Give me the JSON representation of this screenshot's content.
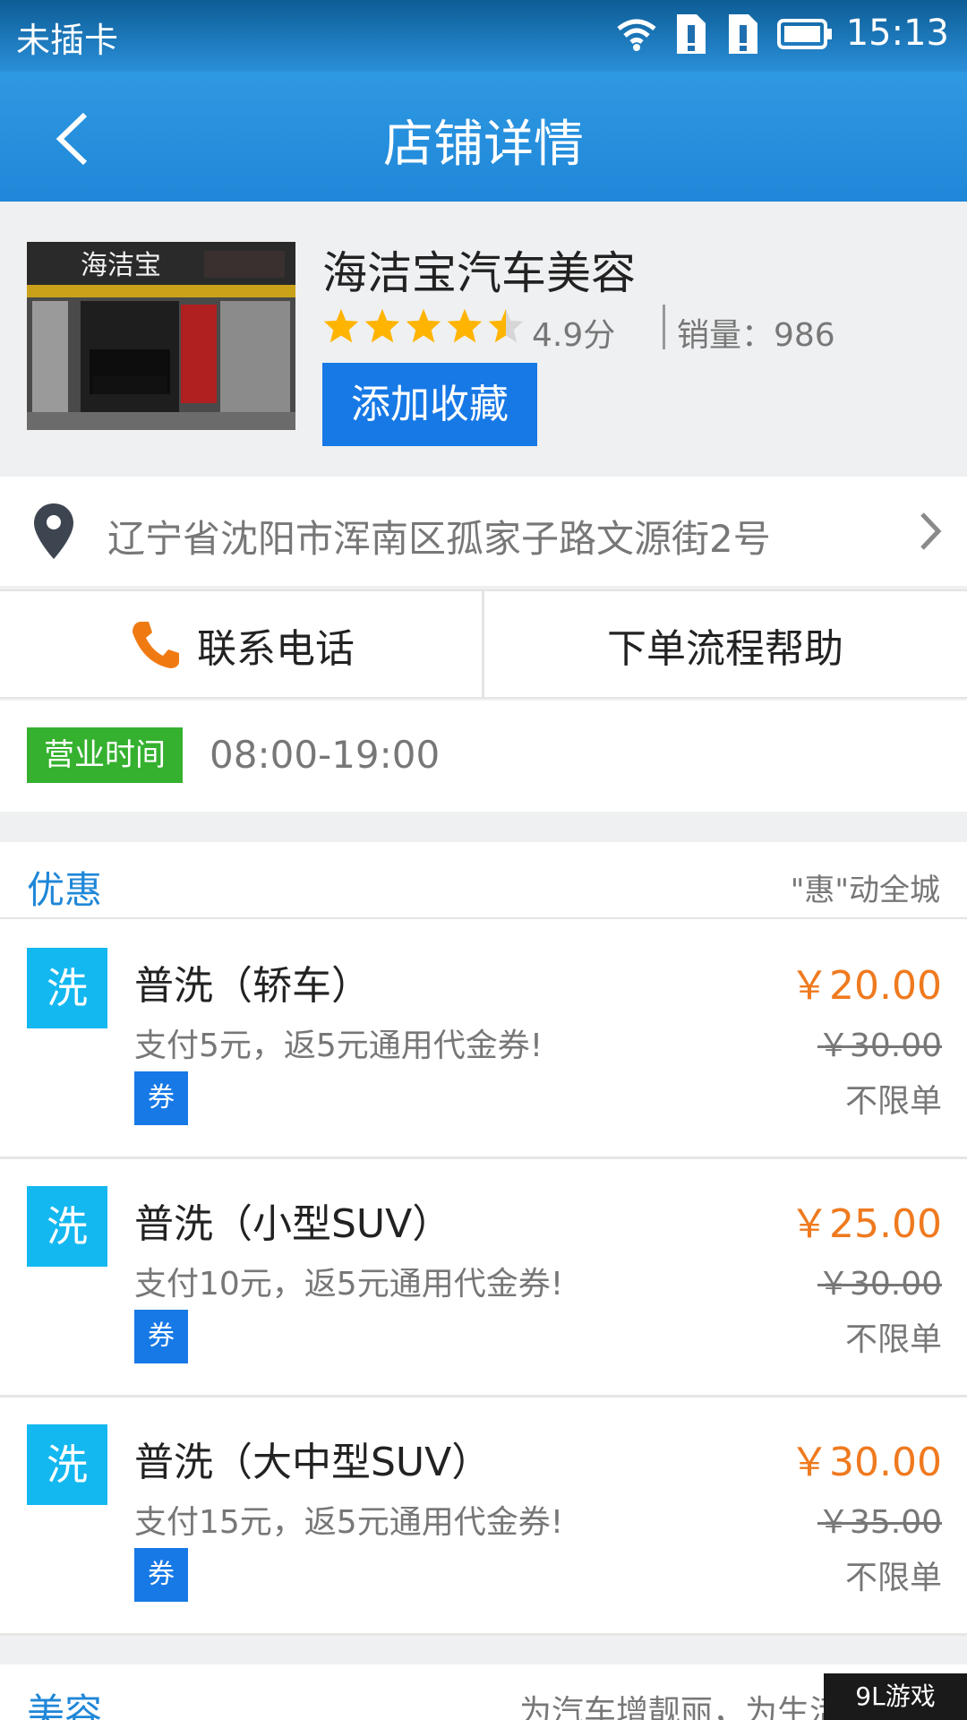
{
  "status_bar": {
    "carrier": "未插卡",
    "time": "15:13",
    "icons": [
      "wifi-icon",
      "sim-alert-icon",
      "sim-alert-icon",
      "battery-icon"
    ]
  },
  "nav": {
    "title": "店铺详情",
    "back_icon": "chevron-left-icon"
  },
  "store": {
    "name": "海洁宝汽车美容",
    "rating": 4.5,
    "score_text": "4.9分",
    "sales_text": "销量：986",
    "favorite_label": "添加收藏",
    "photo_sign": "海洁宝"
  },
  "address": {
    "text": "辽宁省沈阳市浑南区孤家子路文源街2号"
  },
  "actions": {
    "phone_label": "联系电话",
    "help_label": "下单流程帮助"
  },
  "hours": {
    "tag": "营业时间",
    "value": "08:00-19:00"
  },
  "deals": {
    "title": "优惠",
    "subtitle": "\"惠\"动全城",
    "items": [
      {
        "icon_text": "洗",
        "name": "普洗（轿车）",
        "desc": "支付5元，返5元通用代金券!",
        "coupon": "券",
        "price": "￥20.00",
        "original": "￥30.00",
        "limit": "不限单"
      },
      {
        "icon_text": "洗",
        "name": "普洗（小型SUV）",
        "desc": "支付10元，返5元通用代金券!",
        "coupon": "券",
        "price": "￥25.00",
        "original": "￥30.00",
        "limit": "不限单"
      },
      {
        "icon_text": "洗",
        "name": "普洗（大中型SUV）",
        "desc": "支付15元，返5元通用代金券!",
        "coupon": "券",
        "price": "￥30.00",
        "original": "￥35.00",
        "limit": "不限单"
      }
    ]
  },
  "beauty": {
    "title": "美容",
    "subtitle": "为汽车增靓丽，为生活"
  },
  "watermark": "9L游戏",
  "colors": {
    "header_blue": "#1f87d8",
    "accent_blue": "#1779e6",
    "price_orange": "#ef7a1f",
    "hours_green": "#35b12f",
    "wash_cyan": "#14b8f0",
    "star_gold": "#ffb400"
  }
}
